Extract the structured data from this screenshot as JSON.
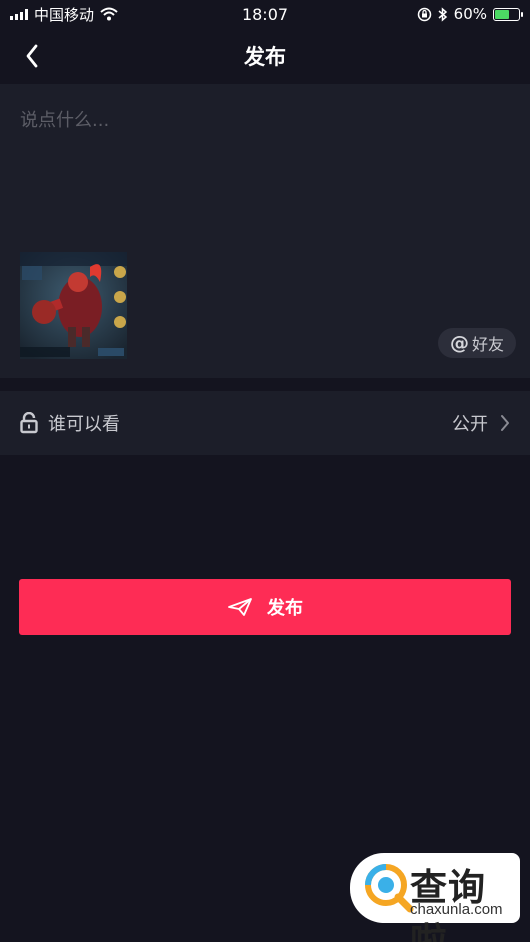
{
  "status_bar": {
    "carrier": "中国移动",
    "time": "18:07",
    "battery": "60%",
    "battery_level": 0.6
  },
  "nav": {
    "title": "发布",
    "back_icon": "chevron-left-icon"
  },
  "compose": {
    "placeholder": "说点什么...",
    "caption_value": "",
    "mention_label": "好友",
    "mention_symbol": "@"
  },
  "privacy": {
    "label": "谁可以看",
    "value": "公开",
    "icon": "unlock-icon"
  },
  "publish_button": {
    "label": "发布",
    "icon": "paper-plane-icon"
  },
  "watermark": {
    "name": "查询啦",
    "domain": "chaxunla.com"
  },
  "colors": {
    "background": "#14141f",
    "panel": "#1c1e29",
    "accent": "#fe2c55",
    "muted_text": "#c8c9cf"
  }
}
